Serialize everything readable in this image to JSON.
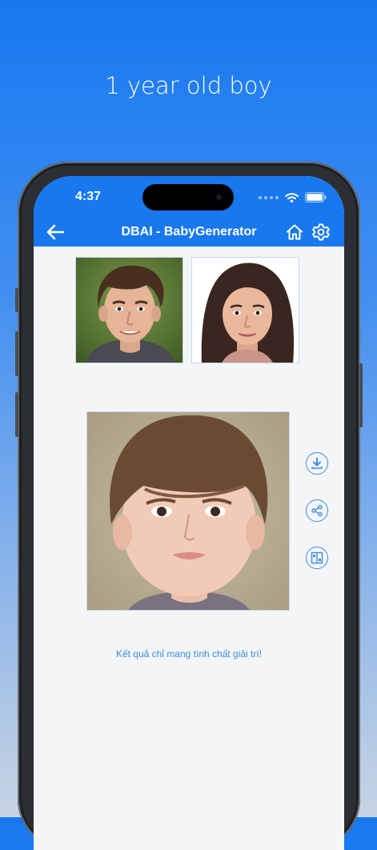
{
  "promo": {
    "title": "1 year old boy"
  },
  "status_bar": {
    "time": "4:37"
  },
  "nav": {
    "title": "DBAI - BabyGenerator"
  },
  "icons": {
    "back": "arrow-left-icon",
    "home": "home-icon",
    "settings": "gear-icon",
    "download": "download-icon",
    "share": "share-icon",
    "compare": "compare-icon"
  },
  "colors": {
    "accent": "#1778f0",
    "icon_blue": "#3d8ee0",
    "background": "#f4f5f7"
  },
  "result": {
    "disclaimer": "Kết quả chỉ mang tính chất giải trí!"
  }
}
